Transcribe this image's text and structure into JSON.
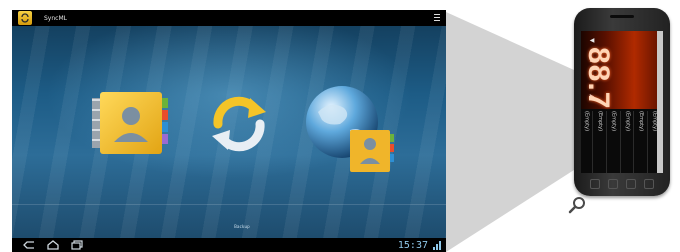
{
  "tablet": {
    "app_title": "SyncML",
    "tile_label": "Backup",
    "clock": "15:37"
  },
  "phone": {
    "frequency": "88.7",
    "presets": [
      "(Empty)",
      "(Empty)",
      "(Empty)",
      "(Empty)",
      "(Empty)",
      "(Empty)"
    ]
  },
  "colors": {
    "accent": "#f0c12a",
    "screen_bg": "#1d5c86",
    "radio_glow": "#b02a00"
  },
  "icons": [
    "sync-app-icon",
    "menu-icon",
    "contacts-book-icon",
    "sync-arrows-icon",
    "globe-contacts-icon",
    "back-icon",
    "home-icon",
    "recents-icon",
    "wifi-icon",
    "magnifier-icon"
  ]
}
